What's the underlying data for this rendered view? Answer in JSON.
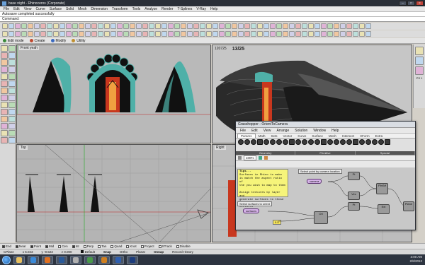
{
  "window": {
    "title": "base night - Rhinoceros (Corporate)",
    "controls": [
      "–",
      "□",
      "×"
    ]
  },
  "menu": [
    "File",
    "Edit",
    "View",
    "Curve",
    "Surface",
    "Solid",
    "Mesh",
    "Dimension",
    "Transform",
    "Tools",
    "Analyze",
    "Render",
    "T-Splines",
    "V-Ray",
    "Help"
  ],
  "command": {
    "history": "Autosave completed successfully",
    "prompt": "Command:"
  },
  "modes": [
    "Edit mode",
    "Create",
    "Modify",
    "Utility"
  ],
  "viewports": {
    "front": "Front yeah",
    "top": "Top",
    "perspective_code": "120725",
    "perspective_counter": "13/25",
    "right": "Right"
  },
  "right_palette": {
    "label": "PS 1"
  },
  "grasshopper": {
    "title": "Grasshopper - OrientToCamera",
    "menu": [
      "File",
      "Edit",
      "View",
      "Arrange",
      "Solution",
      "Window",
      "Help"
    ],
    "tabs": [
      "Params",
      "Math",
      "Sets",
      "Vector",
      "Curve",
      "Surface",
      "Mesh",
      "Intersect",
      "XForm",
      "Extra"
    ],
    "active_tab": "Params",
    "groups": [
      "Geometry",
      "Primitive",
      "Special"
    ],
    "zoom": "100%",
    "note_title": "Tips...",
    "note_text": "Surfaces in Rhino to make\nis match the aspect ratio of\nthe you wish to map to them\n\nAssign textures by layer and\ngenerate surfaces to those\nand having to remap textures",
    "label_select_point": "Select point by camera location",
    "label_select_surfaces": "Select surfaces to orient",
    "pill_camera": "camera",
    "pill_surfaces": "surfaces",
    "nodes": [
      "Pt",
      "Vec",
      "PlnSrf",
      "Pt",
      "Ori",
      "Ext",
      "Plane"
    ],
    "value_box": "0.5"
  },
  "osnap": [
    {
      "label": "End",
      "on": true
    },
    {
      "label": "Near",
      "on": true
    },
    {
      "label": "Point",
      "on": true
    },
    {
      "label": "Mid",
      "on": true
    },
    {
      "label": "Cen",
      "on": false
    },
    {
      "label": "Int",
      "on": true
    },
    {
      "label": "Perp",
      "on": false
    },
    {
      "label": "Tan",
      "on": false
    },
    {
      "label": "Quad",
      "on": false
    },
    {
      "label": "Knot",
      "on": false
    },
    {
      "label": "Project",
      "on": false
    },
    {
      "label": "STrack",
      "on": false
    },
    {
      "label": "Disable",
      "on": false
    }
  ],
  "status": {
    "cplane": "CPlane",
    "x": "x 5.043",
    "y": "y -9.523",
    "z": "z 0.000",
    "layer": "Default",
    "snap": "Snap",
    "ortho": "Ortho",
    "planar": "Planar",
    "osnap": "Osnap",
    "record": "Record History"
  },
  "tray": {
    "time": "3:00 AM",
    "date": "2/8/2012"
  },
  "taskbar_apps": [
    {
      "name": "explorer",
      "color": "#e8c060"
    },
    {
      "name": "media",
      "color": "#3a8ad8"
    },
    {
      "name": "firefox",
      "color": "#e07020"
    },
    {
      "name": "photoshop",
      "color": "#2a5a9a"
    },
    {
      "name": "rhino",
      "color": "#b0b0b0"
    },
    {
      "name": "grasshopper",
      "color": "#4a9a4a"
    },
    {
      "name": "illustrator",
      "color": "#d08020"
    },
    {
      "name": "word",
      "color": "#3060b0"
    },
    {
      "name": "ps",
      "color": "#1c3c7c"
    }
  ],
  "accent_colors": {
    "teal_surface": "#4fb0a8",
    "curtain_red": "#c8371e",
    "gh_pill": "#d6b4e8",
    "note_yellow": "#f6f47a"
  }
}
